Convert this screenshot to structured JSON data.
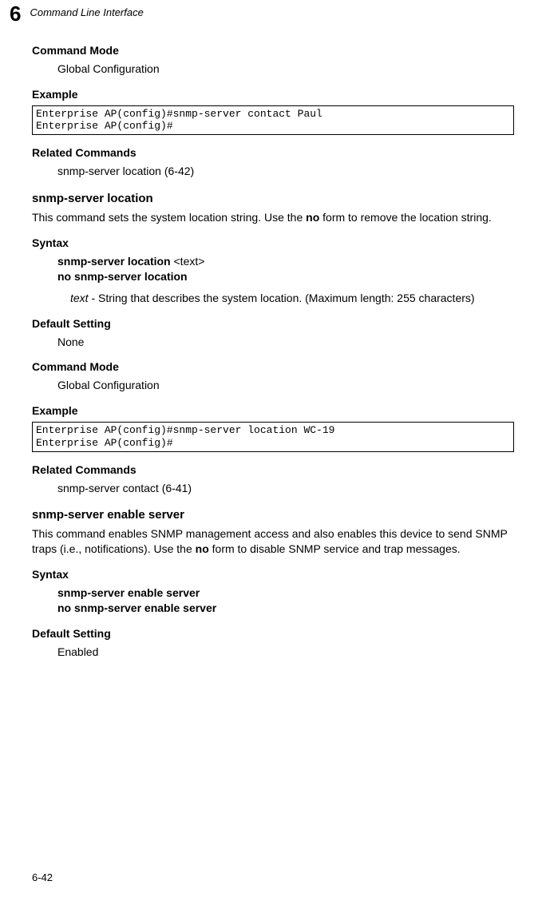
{
  "header": {
    "chapter_num": "6",
    "running_head": "Command Line Interface"
  },
  "s1": {
    "h_cmdmode": "Command Mode",
    "cmdmode_val": "Global Configuration",
    "h_example": "Example",
    "example_code": "Enterprise AP(config)#snmp-server contact Paul\nEnterprise AP(config)#",
    "h_related": "Related Commands",
    "related_val": "snmp-server location (6-42)"
  },
  "cmd_location": {
    "title": "snmp-server location",
    "desc_pre": "This command sets the system location string. Use the ",
    "desc_bold": "no",
    "desc_post": " form to remove the location string.",
    "h_syntax": "Syntax",
    "syntax_l1_bold": "snmp-server location ",
    "syntax_l1_arg": "<text>",
    "syntax_l2": "no snmp-server location",
    "arg_name": "text",
    "arg_desc": " - String that describes the system location. (Maximum length: 255 characters)",
    "h_default": "Default Setting",
    "default_val": "None",
    "h_cmdmode": "Command Mode",
    "cmdmode_val": "Global Configuration",
    "h_example": "Example",
    "example_code": "Enterprise AP(config)#snmp-server location WC-19\nEnterprise AP(config)#",
    "h_related": "Related Commands",
    "related_val": "snmp-server contact (6-41)"
  },
  "cmd_enable": {
    "title": "snmp-server enable server",
    "desc_pre": "This command enables SNMP management access and also enables this device to send SNMP traps (i.e., notifications). Use the ",
    "desc_bold": "no",
    "desc_post": " form to disable SNMP service and trap messages.",
    "h_syntax": "Syntax",
    "syntax_l1": "snmp-server enable server",
    "syntax_l2": "no snmp-server enable server",
    "h_default": "Default Setting",
    "default_val": "Enabled"
  },
  "footer": {
    "page_num": "6-42"
  }
}
